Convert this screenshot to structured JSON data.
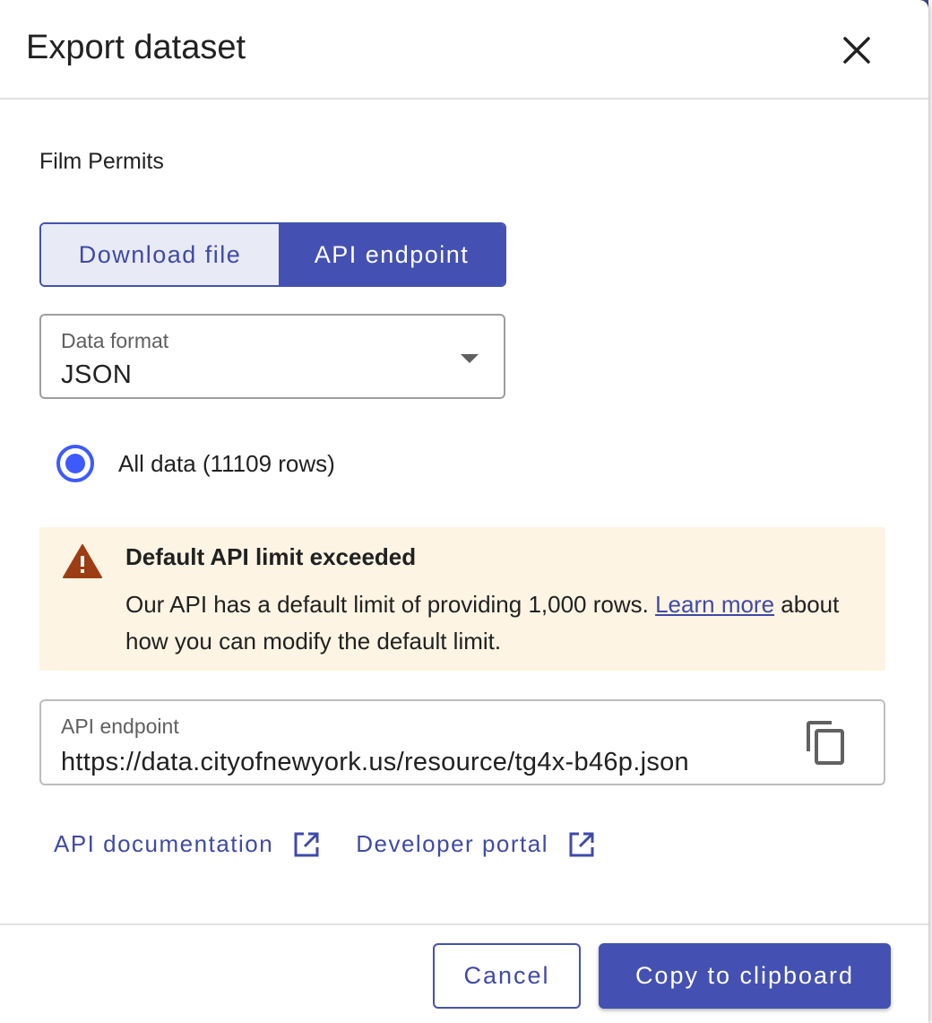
{
  "dialog": {
    "title": "Export dataset",
    "dataset_name": "Film Permits"
  },
  "mode_toggle": {
    "options": [
      {
        "label": "Download file",
        "selected": false
      },
      {
        "label": "API endpoint",
        "selected": true
      }
    ]
  },
  "data_format": {
    "label": "Data format",
    "value": "JSON"
  },
  "row_selection": {
    "label": "All data (11109 rows)",
    "selected": true
  },
  "alert": {
    "title": "Default API limit exceeded",
    "body_before_link": "Our API has a default limit of providing 1,000 rows. ",
    "link_text": "Learn more",
    "body_after_link": " about how you can modify the default limit."
  },
  "endpoint": {
    "label": "API endpoint",
    "url": "https://data.cityofnewyork.us/resource/tg4x-b46p.json"
  },
  "links": {
    "api_documentation": "API documentation",
    "developer_portal": "Developer portal"
  },
  "footer": {
    "cancel_label": "Cancel",
    "copy_label": "Copy to clipboard"
  },
  "colors": {
    "primary": "#4451b2",
    "radio": "#3d5afe",
    "alert_bg": "#fdf4e4",
    "warning_icon": "#9c3d14"
  }
}
